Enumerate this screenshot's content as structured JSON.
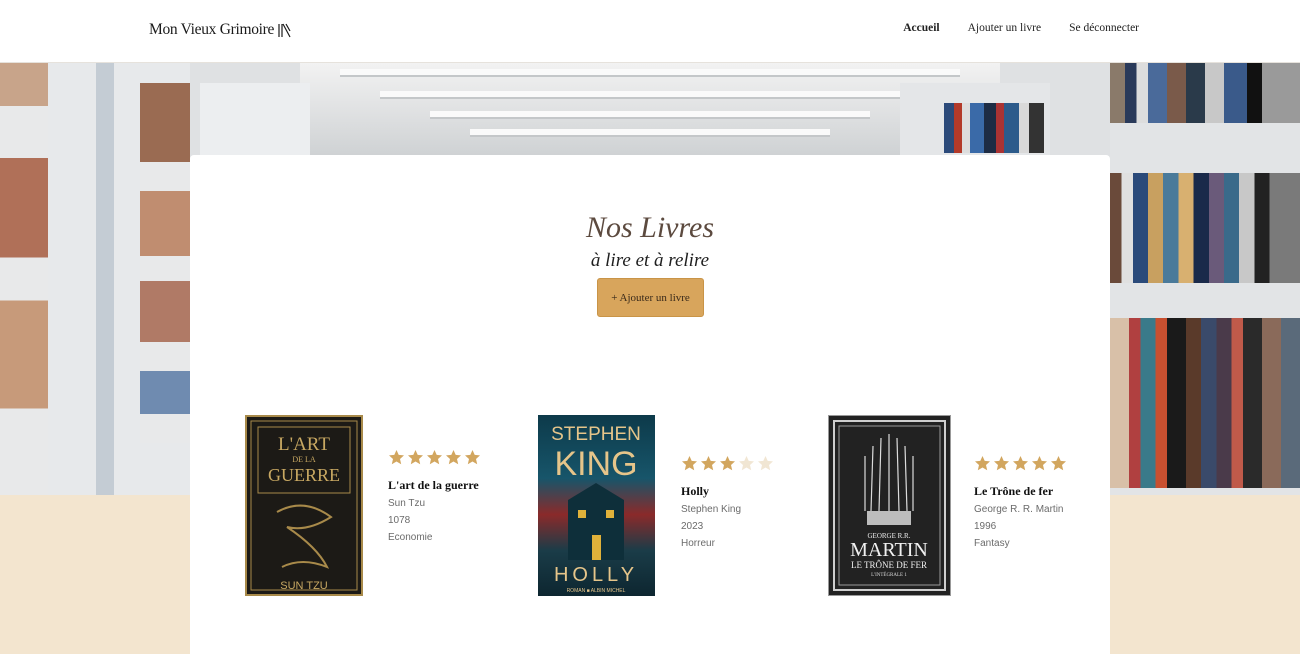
{
  "header": {
    "logo_text": "Mon Vieux Grimoire",
    "nav": [
      {
        "label": "Accueil",
        "active": true
      },
      {
        "label": "Ajouter un livre",
        "active": false
      },
      {
        "label": "Se déconnecter",
        "active": false
      }
    ]
  },
  "main": {
    "title": "Nos Livres",
    "subtitle": "à lire et à relire",
    "add_button_label": "+ Ajouter un livre"
  },
  "books": [
    {
      "title": "L'art de la guerre",
      "author": "Sun Tzu",
      "year": "1078",
      "genre": "Economie",
      "rating": 5,
      "cover_text": {
        "line1": "L'ART",
        "line2": "DE LA",
        "line3": "GUERRE",
        "author": "SUN TZU"
      }
    },
    {
      "title": "Holly",
      "author": "Stephen King",
      "year": "2023",
      "genre": "Horreur",
      "rating": 3,
      "cover_text": {
        "line1": "STEPHEN",
        "line2": "KING",
        "line3": "HOLLY",
        "footer": "ROMAN ■ ALBIN MICHEL"
      }
    },
    {
      "title": "Le Trône de fer",
      "author": "George R. R. Martin",
      "year": "1996",
      "genre": "Fantasy",
      "rating": 5,
      "cover_text": {
        "line1": "GEORGE R.R.",
        "line2": "MARTIN",
        "line3": "LE TRÔNE DE FER",
        "line4": "L'INTÉGRALE 1"
      }
    }
  ],
  "colors": {
    "accent": "#d8a55c",
    "star_filled": "#d2a65f",
    "star_empty": "#f1e6d3",
    "page_bg": "#f3e5cf"
  }
}
